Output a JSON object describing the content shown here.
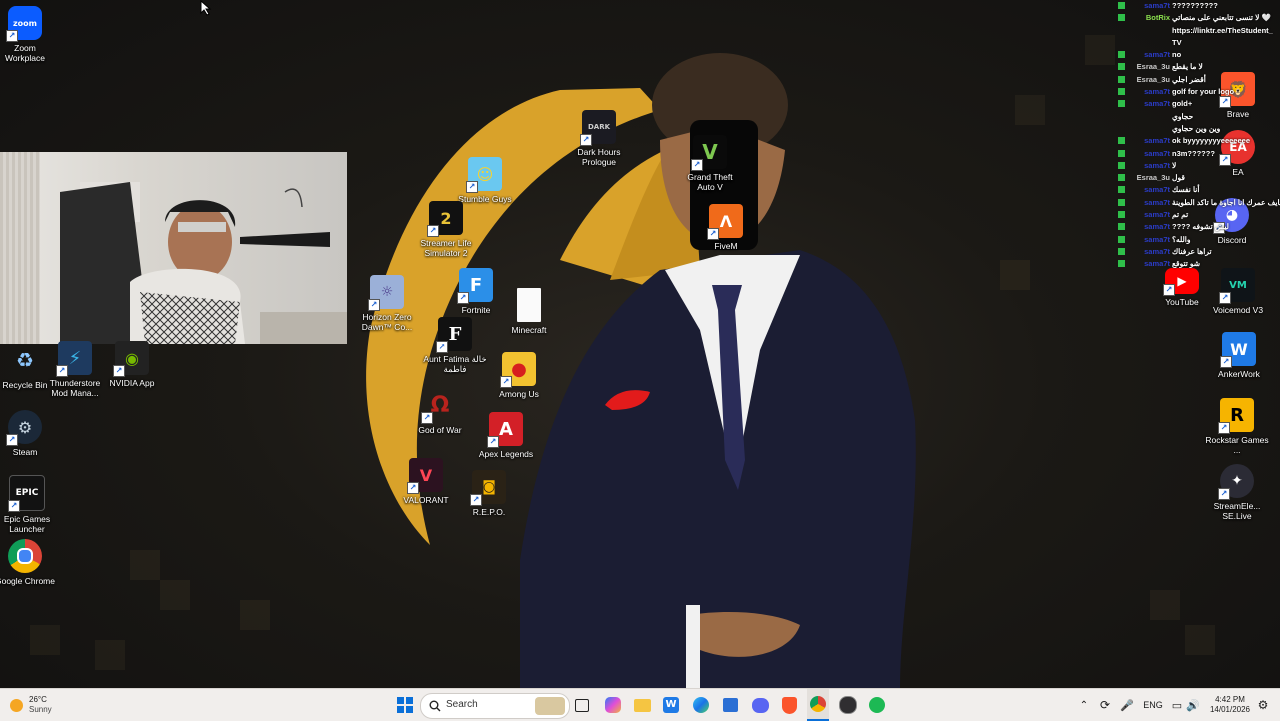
{
  "desktop_icons": {
    "zoom": {
      "label": "Zoom Workplace",
      "icon": "zoom-icon",
      "color": "#0b5cff"
    },
    "recycle": {
      "label": "Recycle Bin",
      "icon": "recycle-bin-icon"
    },
    "thunderstore": {
      "label": "Thunderstore Mod Mana...",
      "icon": "thunderstore-icon"
    },
    "nvidia": {
      "label": "NVIDIA App",
      "icon": "nvidia-icon",
      "color": "#76b900"
    },
    "steam": {
      "label": "Steam",
      "icon": "steam-icon"
    },
    "epic": {
      "label": "Epic Games Launcher",
      "icon": "epic-games-icon"
    },
    "chrome": {
      "label": "Google Chrome",
      "icon": "chrome-icon"
    },
    "darkhours": {
      "label": "Dark Hours Prologue",
      "icon": "dark-hours-icon"
    },
    "gta": {
      "label": "Grand Theft Auto V",
      "icon": "gta-v-icon"
    },
    "fivem": {
      "label": "FiveM",
      "icon": "fivem-icon",
      "color": "#f06a1a"
    },
    "stumble": {
      "label": "Stumble Guys",
      "icon": "stumble-guys-icon"
    },
    "streamerlife": {
      "label": "Streamer Life Simulator 2",
      "icon": "streamer-life-icon"
    },
    "fortnite": {
      "label": "Fortnite",
      "icon": "fortnite-icon"
    },
    "horizon": {
      "label": "Horizon Zero Dawn™ Co...",
      "icon": "horizon-icon"
    },
    "minecraft": {
      "label": "Minecraft",
      "icon": "file-icon"
    },
    "auntfatima": {
      "label": "Aunt Fatima خالة فاطمة",
      "icon": "aunt-fatima-icon"
    },
    "amongus": {
      "label": "Among Us",
      "icon": "among-us-icon"
    },
    "gow": {
      "label": "God of War",
      "icon": "god-of-war-icon"
    },
    "apex": {
      "label": "Apex Legends",
      "icon": "apex-icon",
      "color": "#d32027"
    },
    "valorant": {
      "label": "VALORANT",
      "icon": "valorant-icon"
    },
    "repo": {
      "label": "R.E.P.O.",
      "icon": "repo-icon"
    },
    "brave": {
      "label": "Brave",
      "icon": "brave-icon",
      "color": "#fb542b"
    },
    "ea": {
      "label": "EA",
      "icon": "ea-icon",
      "color": "#e8322e"
    },
    "discord": {
      "label": "Discord",
      "icon": "discord-icon",
      "color": "#5865f2"
    },
    "youtube": {
      "label": "YouTube",
      "icon": "youtube-icon",
      "color": "#ff0000"
    },
    "voicemod": {
      "label": "Voicemod V3",
      "icon": "voicemod-icon"
    },
    "ankerwork": {
      "label": "AnkerWork",
      "icon": "ankerwork-icon",
      "color": "#1f7ae6"
    },
    "rockstar": {
      "label": "Rockstar Games ...",
      "icon": "rockstar-icon",
      "color": "#f6b400"
    },
    "streamelements": {
      "label": "StreamEle... SE.Live",
      "icon": "streamelements-icon"
    }
  },
  "chat": {
    "messages": [
      {
        "user": "sama7t",
        "text": "??????????",
        "user_color": "#2b3cc8"
      },
      {
        "user": "BotRix",
        "text": "لا تنسى تتابعني على منصاتي 🤍",
        "user_color": "#8be04e"
      },
      {
        "user": "",
        "text": "https://linktr.ee/TheStudent_",
        "user_color": "#ffffff"
      },
      {
        "user": "",
        "text": "TV",
        "user_color": "#ffffff"
      },
      {
        "user": "sama7t",
        "text": "no",
        "user_color": "#2b3cc8"
      },
      {
        "user": "Esraa_3u",
        "text": "لا ما يقطع",
        "user_color": "#c9c9c9"
      },
      {
        "user": "Esraa_3u",
        "text": "أقضر اجلي",
        "user_color": "#c9c9c9"
      },
      {
        "user": "sama7t",
        "text": "golf for your logo",
        "user_color": "#2b3cc8"
      },
      {
        "user": "sama7t",
        "text": "gold+",
        "user_color": "#2b3cc8"
      },
      {
        "user": "",
        "text": "حجاوي",
        "user_color": "#ffffff"
      },
      {
        "user": "",
        "text": "وين وين حجاوي",
        "user_color": "#ffffff"
      },
      {
        "user": "sama7t",
        "text": "ok byyyyyyyyeeeeeee",
        "user_color": "#2b3cc8"
      },
      {
        "user": "sama7t",
        "text": "n3m??????",
        "user_color": "#2b3cc8"
      },
      {
        "user": "sama7t",
        "text": "لا",
        "user_color": "#2b3cc8"
      },
      {
        "user": "Esraa_3u",
        "text": "قول",
        "user_color": "#c9c9c9"
      },
      {
        "user": "sama7t",
        "text": "أنا نفسك",
        "user_color": "#2b3cc8"
      },
      {
        "user": "sama7t",
        "text": "شايف عمرك انا اجاوة ما تاكد الطوينة",
        "user_color": "#2b3cc8"
      },
      {
        "user": "sama7t",
        "text": "تم تم",
        "user_color": "#2b3cc8"
      },
      {
        "user": "sama7t",
        "text": "???? ليش تشوفه",
        "user_color": "#2b3cc8"
      },
      {
        "user": "sama7t",
        "text": "والله؟",
        "user_color": "#2b3cc8"
      },
      {
        "user": "sama7t",
        "text": "تراها عرفناك",
        "user_color": "#2b3cc8"
      },
      {
        "user": "sama7t",
        "text": "شو تتوقع",
        "user_color": "#2b3cc8"
      }
    ]
  },
  "taskbar": {
    "weather_temp": "26°C",
    "weather_desc": "Sunny",
    "search_placeholder": "Search",
    "language": "ENG",
    "time": "4:42 PM",
    "date": "14/01/2026",
    "apps": [
      "windows-start-icon",
      "task-view-icon",
      "copilot-icon",
      "file-explorer-icon",
      "ankerwork-icon",
      "edge-icon",
      "microsoft-store-icon",
      "discord-icon",
      "brave-icon",
      "chrome-icon",
      "obs-icon",
      "spotify-icon"
    ]
  },
  "colors": {
    "wallpaper_accent": "#d9a22a",
    "taskbar_bg": "#f1eeec",
    "chat_badge_green": "#2fbf4a"
  }
}
